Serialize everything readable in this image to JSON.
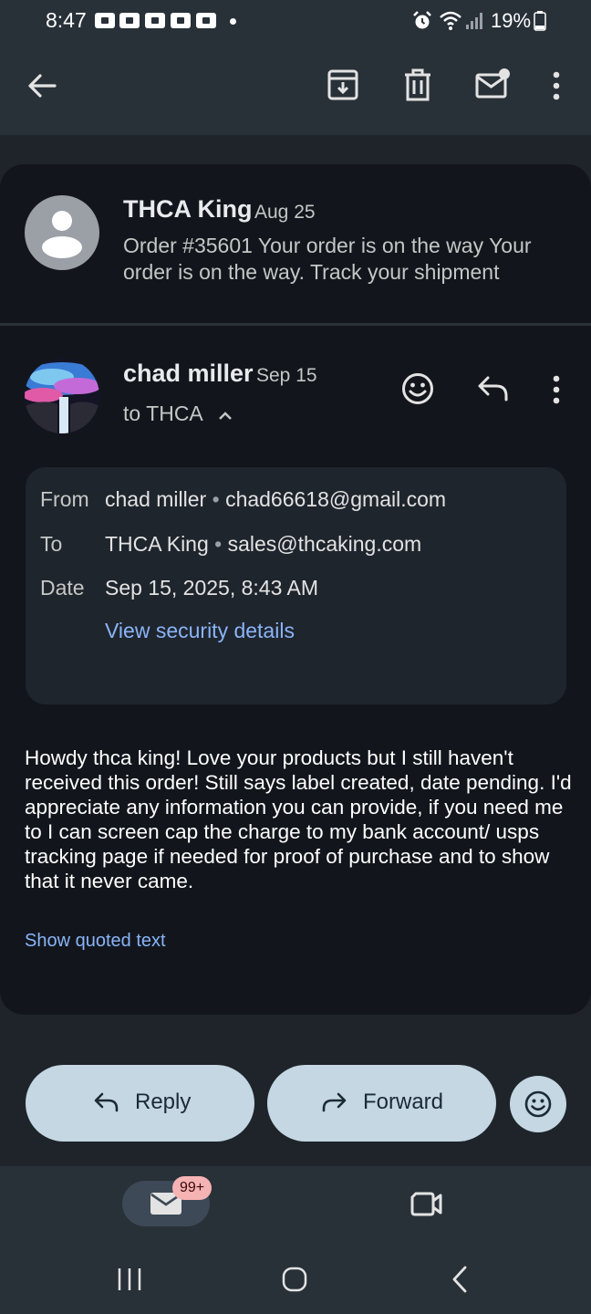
{
  "status_bar": {
    "time": "8:47",
    "battery": "19%",
    "icons": [
      "alarm-icon",
      "wifi-icon",
      "signal-icon",
      "battery-icon"
    ]
  },
  "top_bar": {
    "icons": [
      "back-arrow-icon",
      "archive-icon",
      "delete-icon",
      "mark-unread-icon",
      "more-vert-icon"
    ]
  },
  "messages": [
    {
      "sender": "THCA King",
      "date": "Aug 25",
      "snippet": "Order #35601 Your order is on the way Your order is on the way. Track your shipment"
    },
    {
      "sender": "chad miller",
      "date": "Sep 15",
      "to": "to THCA"
    }
  ],
  "details": {
    "from_label": "From",
    "from_name": "chad miller",
    "from_email": "chad66618@gmail.com",
    "to_label": "To",
    "to_name": "THCA King",
    "to_email": "sales@thcaking.com",
    "date_label": "Date",
    "date_value": "Sep 15, 2025, 8:43 AM",
    "security_link": "View security details",
    "separator": "•"
  },
  "body": "Howdy thca king! Love your products but I still haven't received this order! Still says label created, date pending. I'd appreciate any information you can provide, if you need me to I can screen cap the charge to my bank account/ usps tracking page if needed for proof of purchase and to show that it never came.",
  "quoted_link": "Show quoted text",
  "actions": {
    "reply": "Reply",
    "forward": "Forward"
  },
  "bottom_nav": {
    "mail_badge": "99+"
  },
  "colors": {
    "background": "#1f242b",
    "panel": "#12161c",
    "pill": "#c4d7e2",
    "link": "#8ab4f8",
    "badge": "#f6b3b3"
  }
}
